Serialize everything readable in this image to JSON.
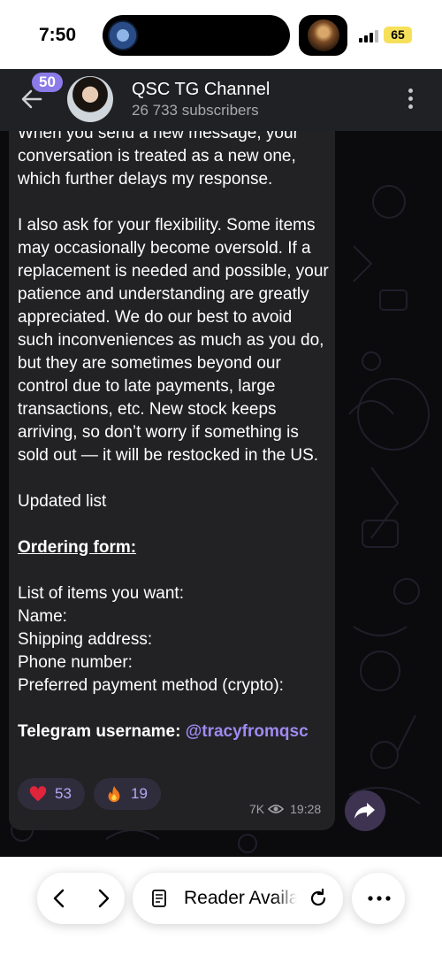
{
  "status_bar": {
    "time": "7:50",
    "battery": "65",
    "battery_color": "#f6e05a"
  },
  "header": {
    "unread_count": "50",
    "channel_name": "QSC TG Channel",
    "subscribers": "26 733 subscribers",
    "icons": [
      "back-arrow-icon",
      "more-vertical-icon"
    ]
  },
  "message": {
    "lines_cut_top": "When you send a new message, your conversation is treated as a new one, which further delays my response.",
    "paragraph_flexibility": "I also ask for your flexibility. Some items may occasionally become oversold. If a replacement is needed and possible, your patience and understanding are greatly appreciated. We do our best to avoid such inconveniences as much as you do, but they are sometimes beyond our control due to late payments, large transactions, etc. New stock keeps arriving, so don’t worry if something is sold out — it will be restocked in the US.",
    "updated_list": "Updated list",
    "ordering_form": "Ordering form:",
    "form_fields": [
      "List of items you want:",
      "Name:",
      "Shipping address:",
      "Phone number:",
      "Preferred payment method (crypto):"
    ],
    "telegram_label": "Telegram username:",
    "telegram_handle": "@tracyfromqsc",
    "reactions": [
      {
        "emoji": "heart",
        "count": "53"
      },
      {
        "emoji": "fire",
        "count": "19"
      }
    ],
    "views": "7K",
    "time": "19:28"
  },
  "browser_toolbar": {
    "reader_label": "Reader Available",
    "icons": [
      "back-chevron-icon",
      "forward-chevron-icon",
      "reader-icon",
      "reload-icon",
      "more-horizontal-icon"
    ]
  },
  "colors": {
    "accent": "#8b7ae8",
    "mention": "#9f8af0",
    "bubble": "#222225",
    "header": "#202124"
  }
}
